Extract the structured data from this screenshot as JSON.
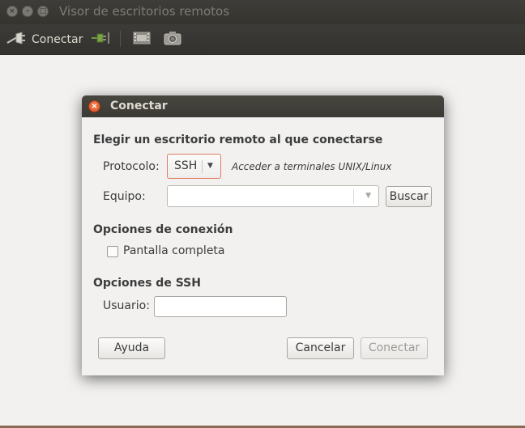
{
  "window": {
    "title": "Visor de escritorios remotos",
    "close_glyph": "×",
    "minimize_glyph": "–",
    "maximize_glyph": "□"
  },
  "toolbar": {
    "connect_label": "Conectar",
    "icons": [
      "connect-icon",
      "disconnect-icon",
      "fullscreen-icon",
      "screenshot-icon"
    ]
  },
  "dialog": {
    "title": "Conectar",
    "close_glyph": "×",
    "choose_heading": "Elegir un escritorio remoto al que conectarse",
    "protocol_label": "Protocolo:",
    "protocol_value": "SSH",
    "protocol_hint": "Acceder a terminales UNIX/Linux",
    "host_label": "Equipo:",
    "host_value": "",
    "search_button": "Buscar",
    "connection_options_heading": "Opciones de conexión",
    "fullscreen_label": "Pantalla completa",
    "fullscreen_checked": false,
    "ssh_options_heading": "Opciones de SSH",
    "user_label": "Usuario:",
    "user_value": "",
    "help_button": "Ayuda",
    "cancel_button": "Cancelar",
    "connect_button": "Conectar"
  },
  "colors": {
    "titlebar": "#3c3b37",
    "background": "#f2f1f0",
    "close_button": "#df4a16",
    "focus_border": "#e07a5f"
  }
}
